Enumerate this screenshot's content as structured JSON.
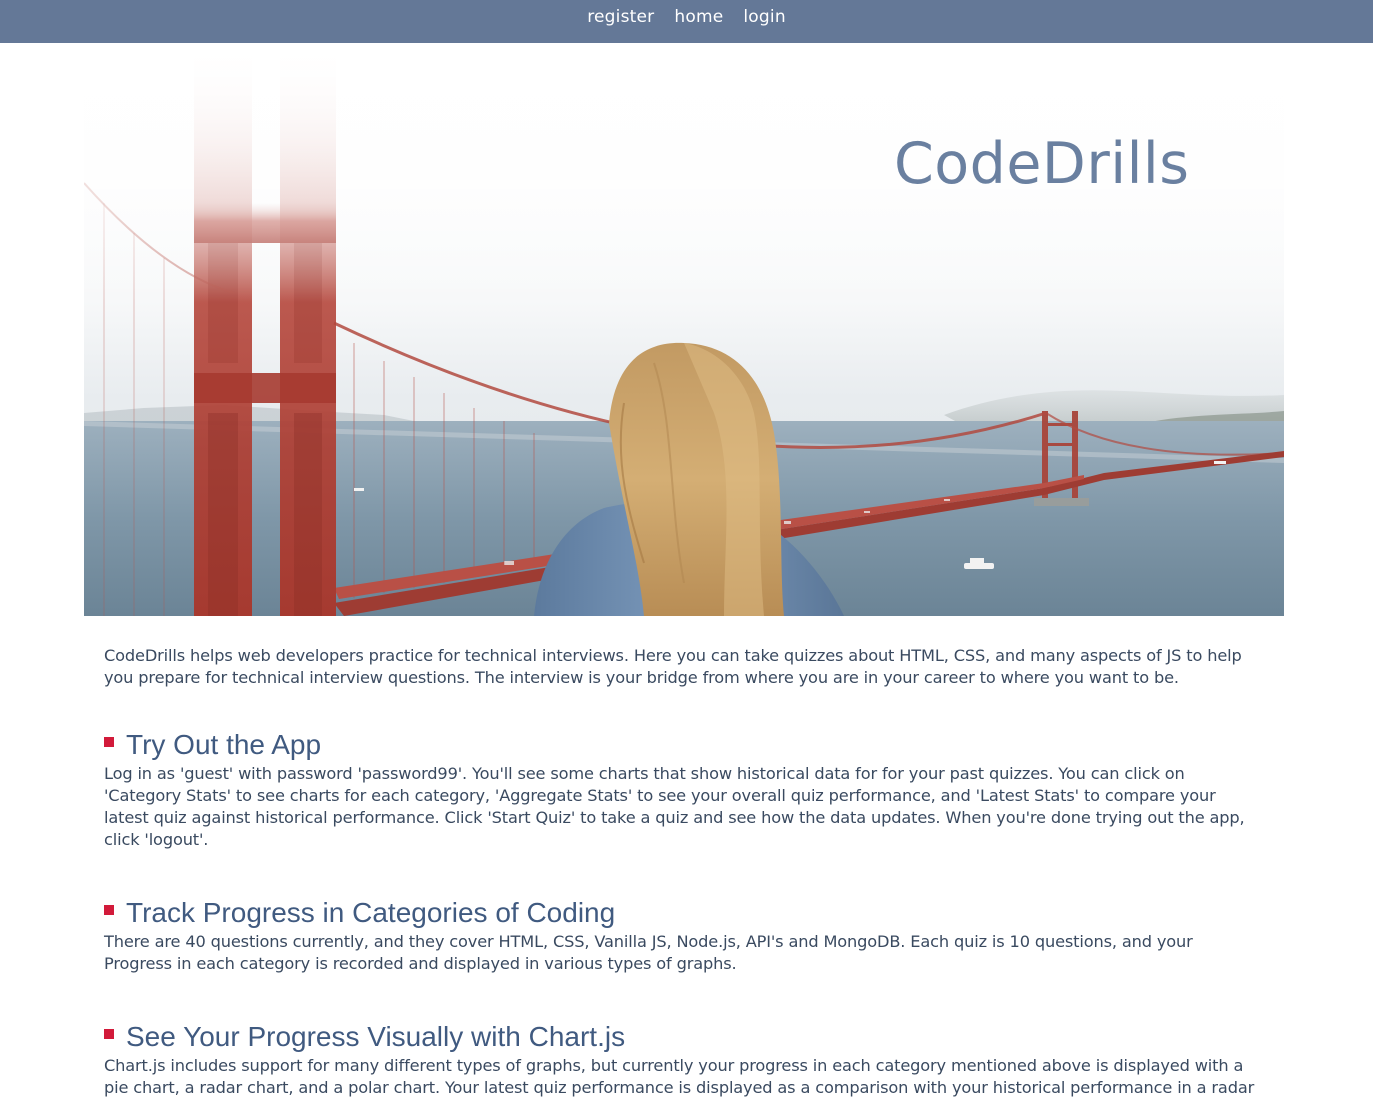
{
  "nav": {
    "links": [
      "register",
      "home",
      "login"
    ]
  },
  "hero": {
    "title": "CodeDrills"
  },
  "intro": {
    "text": "CodeDrills helps web developers practice for technical interviews. Here you can take quizzes about HTML, CSS, and many aspects of JS to help you prepare for technical interview questions. The interview is your bridge from where you are in your career to where you want to be."
  },
  "sections": [
    {
      "heading": "Try Out the App",
      "text": "Log in as 'guest' with password 'password99'. You'll see some charts that show historical data for for your past quizzes. You can click on 'Category Stats' to see charts for each category, 'Aggregate Stats' to see your overall quiz performance, and 'Latest Stats' to compare your latest quiz against historical performance. Click 'Start Quiz' to take a quiz and see how the data updates. When you're done trying out the app, click 'logout'."
    },
    {
      "heading": "Track Progress in Categories of Coding",
      "text": "There are 40 questions currently, and they cover HTML, CSS, Vanilla JS, Node.js, API's and MongoDB. Each quiz is 10 questions, and your Progress in each category is recorded and displayed in various types of graphs."
    },
    {
      "heading": "See Your Progress Visually with Chart.js",
      "text": "Chart.js includes support for many different types of graphs, but currently your progress in each category mentioned above is displayed with a pie chart, a radar chart, and a polar chart. Your latest quiz performance is displayed as a comparison with your historical performance in a radar chart."
    }
  ],
  "colors": {
    "nav_bg": "#647897",
    "title": "#6a80a0",
    "heading": "#405a80",
    "bullet": "#d21a3a"
  }
}
